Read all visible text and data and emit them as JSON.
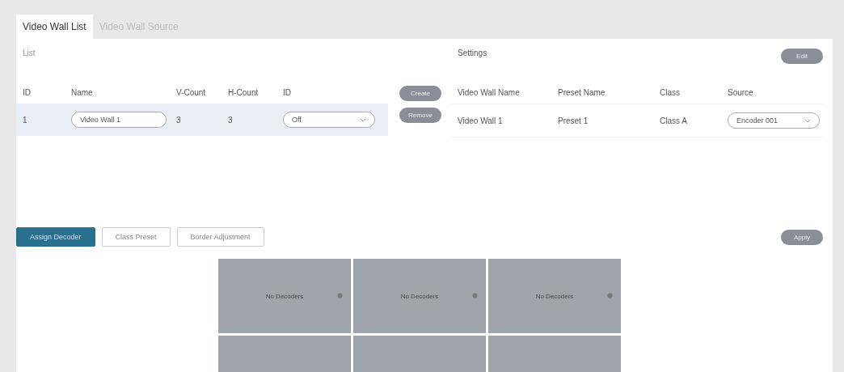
{
  "tabs": [
    {
      "label": "Video Wall List",
      "selected": true
    },
    {
      "label": "Video Wall Source",
      "selected": false
    }
  ],
  "list": {
    "title": "List",
    "columns": [
      "ID",
      "Name",
      "V-Count",
      "H-Count",
      "ID"
    ],
    "rows": [
      {
        "id": "1",
        "name": "Video Wall 1",
        "v_count": "3",
        "h_count": "3",
        "id_select": "Off",
        "selected": true
      }
    ],
    "buttons": [
      "Create",
      "Remove"
    ]
  },
  "settings": {
    "title": "Settings",
    "button": "Edit",
    "columns": [
      "Video Wall Name",
      "Preset Name",
      "Class",
      "Source"
    ],
    "rows": [
      {
        "video_wall_name": "Video Wall 1",
        "preset_name": "Preset 1",
        "class": "Class A",
        "source": "Encoder 001"
      }
    ]
  },
  "modes": [
    {
      "label": "Assign Decoder",
      "selected": true
    },
    {
      "label": "Class Preset",
      "selected": false
    },
    {
      "label": "Border Adjustment",
      "selected": false
    }
  ],
  "apply_button": "Apply",
  "wall_cells": [
    {
      "label": "No Decoders"
    },
    {
      "label": "No Decoders"
    },
    {
      "label": "No Decoders"
    },
    {},
    {},
    {}
  ]
}
